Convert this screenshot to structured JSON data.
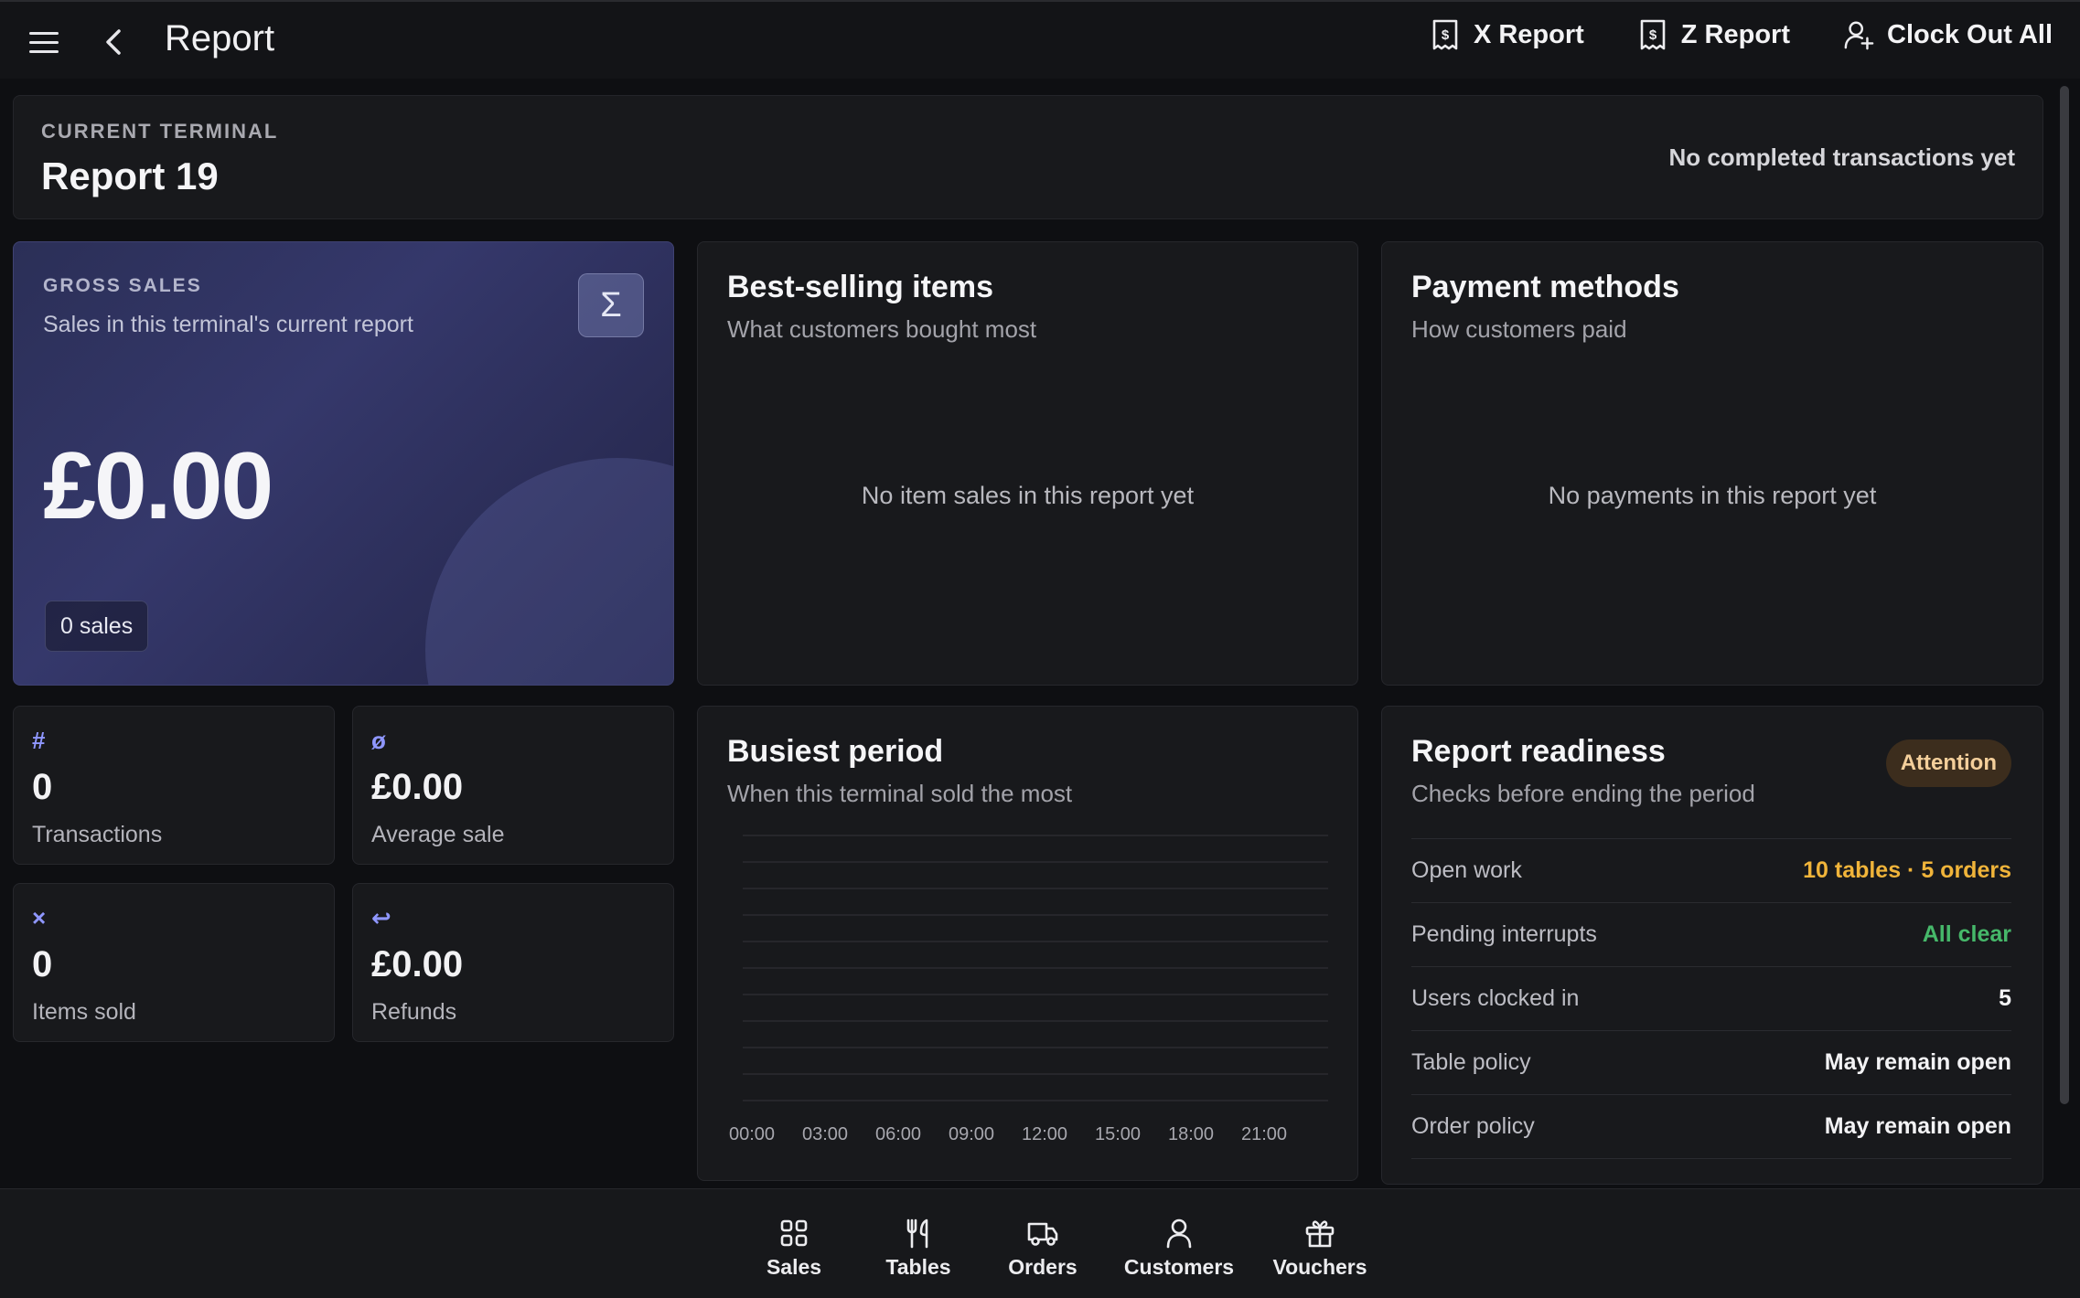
{
  "topbar": {
    "title": "Report",
    "actions": [
      {
        "label": "X Report",
        "icon": "receipt-icon"
      },
      {
        "label": "Z Report",
        "icon": "receipt-icon"
      },
      {
        "label": "Clock Out All",
        "icon": "user-plus-icon"
      }
    ]
  },
  "terminal": {
    "eyebrow": "CURRENT TERMINAL",
    "title": "Report 19",
    "status": "No completed transactions yet"
  },
  "gross_sales": {
    "eyebrow": "GROSS SALES",
    "subtitle": "Sales in this terminal's current report",
    "value": "£0.00",
    "sales_count": "0 sales",
    "icon": "sigma-icon"
  },
  "stats": [
    {
      "icon": "#",
      "value": "0",
      "label": "Transactions"
    },
    {
      "icon": "ø",
      "value": "£0.00",
      "label": "Average sale"
    },
    {
      "icon": "×",
      "value": "0",
      "label": "Items sold"
    },
    {
      "icon": "↩",
      "value": "£0.00",
      "label": "Refunds"
    }
  ],
  "best_selling": {
    "title": "Best-selling items",
    "subtitle": "What customers bought most",
    "empty": "No item sales in this report yet"
  },
  "payment_methods": {
    "title": "Payment methods",
    "subtitle": "How customers paid",
    "empty": "No payments in this report yet"
  },
  "busiest": {
    "title": "Busiest period",
    "subtitle": "When this terminal sold the most"
  },
  "chart_data": {
    "type": "bar",
    "title": "",
    "categories": [
      "00:00",
      "03:00",
      "06:00",
      "09:00",
      "12:00",
      "15:00",
      "18:00",
      "21:00"
    ],
    "values": [
      0,
      0,
      0,
      0,
      0,
      0,
      0,
      0
    ],
    "grid": true
  },
  "readiness": {
    "title": "Report readiness",
    "subtitle": "Checks before ending the period",
    "badge": "Attention",
    "rows": [
      {
        "key": "Open work",
        "value": "10 tables · 5 orders",
        "status": "warn"
      },
      {
        "key": "Pending interrupts",
        "value": "All clear",
        "status": "ok"
      },
      {
        "key": "Users clocked in",
        "value": "5",
        "status": "normal"
      },
      {
        "key": "Table policy",
        "value": "May remain open",
        "status": "normal"
      },
      {
        "key": "Order policy",
        "value": "May remain open",
        "status": "normal"
      }
    ]
  },
  "bottomnav": {
    "items": [
      {
        "label": "Sales",
        "icon": "grid-icon"
      },
      {
        "label": "Tables",
        "icon": "utensils-icon"
      },
      {
        "label": "Orders",
        "icon": "truck-icon"
      },
      {
        "label": "Customers",
        "icon": "user-icon"
      },
      {
        "label": "Vouchers",
        "icon": "gift-icon"
      }
    ]
  },
  "colors": {
    "background": "#0e0f12",
    "card": "#18191c",
    "accent": "#8f97ff",
    "warn": "#f0b43a",
    "ok": "#46b86a"
  }
}
